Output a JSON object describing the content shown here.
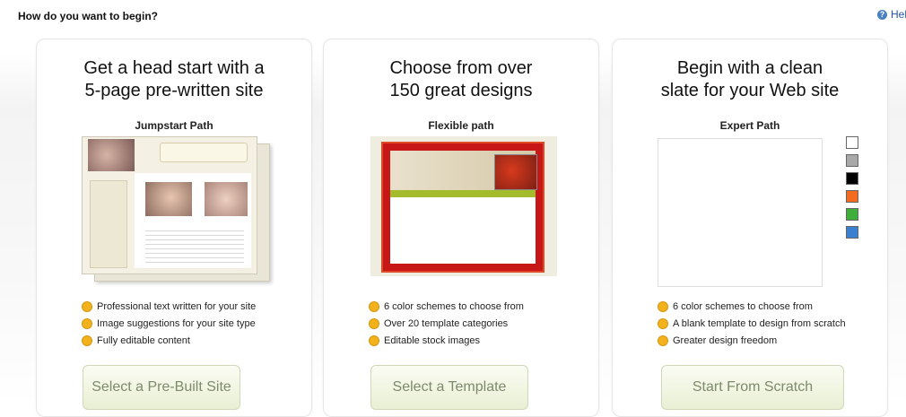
{
  "header": {
    "question": "How do you want to begin?",
    "help_label": "Help"
  },
  "cards": [
    {
      "headline_1": "Get a head start with a",
      "headline_2": "5-page pre-written site",
      "path_title": "Jumpstart Path",
      "bullets": [
        "Professional text written for your site",
        "Image suggestions for your site type",
        "Fully editable content"
      ],
      "button_label": "Select a Pre-Built Site"
    },
    {
      "headline_1": "Choose from over",
      "headline_2": "150 great designs",
      "path_title": "Flexible path",
      "bullets": [
        "6 color schemes to choose from",
        "Over 20 template categories",
        "Editable stock images"
      ],
      "button_label": "Select a Template"
    },
    {
      "headline_1": "Begin with a clean",
      "headline_2": "slate for your Web site",
      "path_title": "Expert Path",
      "bullets": [
        "6 color schemes to choose from",
        "A blank template to design from scratch",
        "Greater design freedom"
      ],
      "button_label": "Start From Scratch"
    }
  ],
  "color_swatches": [
    "#ffffff",
    "#a8a8a8",
    "#000000",
    "#f26b21",
    "#3fae3a",
    "#3b7fd0"
  ]
}
